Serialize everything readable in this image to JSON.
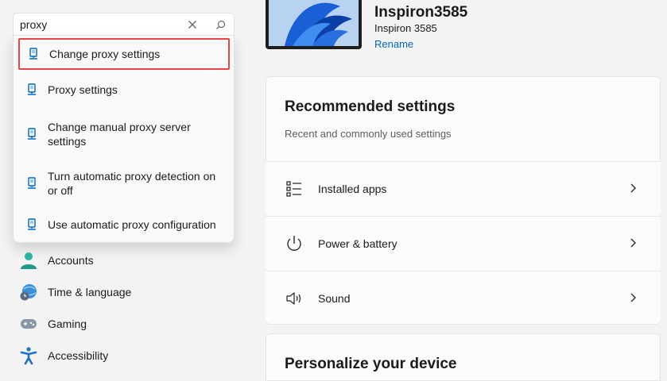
{
  "search": {
    "value": "proxy",
    "suggestions": [
      {
        "label": "Change proxy settings",
        "icon": "proxy-settings-icon"
      },
      {
        "label": "Proxy settings",
        "icon": "proxy-settings-icon"
      },
      {
        "label": "Change manual proxy server settings",
        "icon": "proxy-settings-icon"
      },
      {
        "label": "Turn automatic proxy detection on or off",
        "icon": "proxy-settings-icon"
      },
      {
        "label": "Use automatic proxy configuration",
        "icon": "proxy-settings-icon"
      }
    ]
  },
  "sidebar": {
    "items": [
      {
        "label": "Accounts",
        "icon": "person-icon"
      },
      {
        "label": "Time & language",
        "icon": "globe-clock-icon"
      },
      {
        "label": "Gaming",
        "icon": "gamepad-icon"
      },
      {
        "label": "Accessibility",
        "icon": "accessibility-icon"
      }
    ]
  },
  "device": {
    "name": "Inspiron3585",
    "model": "Inspiron 3585",
    "rename_label": "Rename"
  },
  "recommended": {
    "title": "Recommended settings",
    "subtitle": "Recent and commonly used settings",
    "items": [
      {
        "label": "Installed apps",
        "icon": "list-icon"
      },
      {
        "label": "Power & battery",
        "icon": "power-icon"
      },
      {
        "label": "Sound",
        "icon": "speaker-icon"
      }
    ]
  },
  "personalize": {
    "title": "Personalize your device"
  },
  "colors": {
    "accent": "#0067c0",
    "highlight_border": "#e64545",
    "background": "#f3f3f3"
  }
}
